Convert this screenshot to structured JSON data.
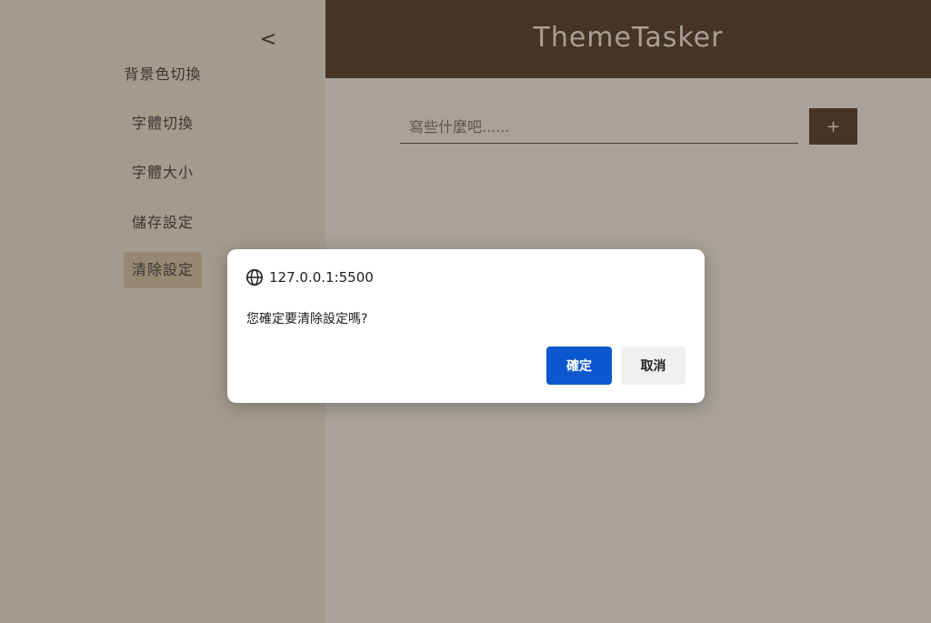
{
  "sidebar": {
    "collapse_label": "<",
    "items": [
      {
        "label": "背景色切換"
      },
      {
        "label": "字體切換"
      },
      {
        "label": "字體大小"
      },
      {
        "label": "儲存設定"
      },
      {
        "label": "清除設定",
        "active": true
      }
    ]
  },
  "header": {
    "title": "ThemeTasker"
  },
  "task_input": {
    "value": "",
    "placeholder": "寫些什麼吧......"
  },
  "add_button": {
    "label": "+"
  },
  "dialog": {
    "origin": "127.0.0.1:5500",
    "origin_icon": "globe-icon",
    "message": "您確定要清除設定嗎?",
    "ok_label": "確定",
    "cancel_label": "取消"
  },
  "colors": {
    "header_bg": "#4f3624",
    "active_item_bg": "#d8c7a8",
    "ok_button": "#0b57d0"
  }
}
